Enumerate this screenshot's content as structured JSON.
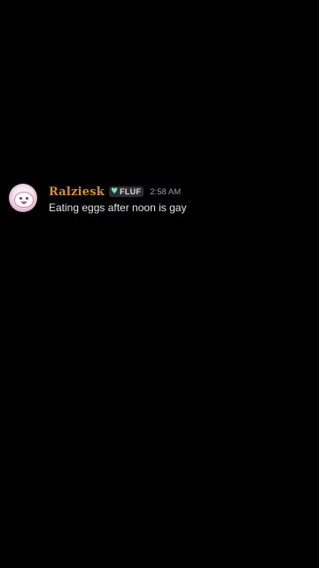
{
  "message": {
    "author": {
      "name": "Ralziesk",
      "name_color": "#d4903c",
      "avatar_icon": "avatar-icon"
    },
    "tag": {
      "icon": "heart-icon",
      "icon_glyph": "💚",
      "icon_color": "#7fe0c0",
      "label": "FLUF"
    },
    "timestamp": "2:58 AM",
    "text": "Eating eggs after noon is gay"
  },
  "colors": {
    "background": "#000000",
    "text": "#e3e5e8",
    "timestamp": "#949ba4"
  }
}
